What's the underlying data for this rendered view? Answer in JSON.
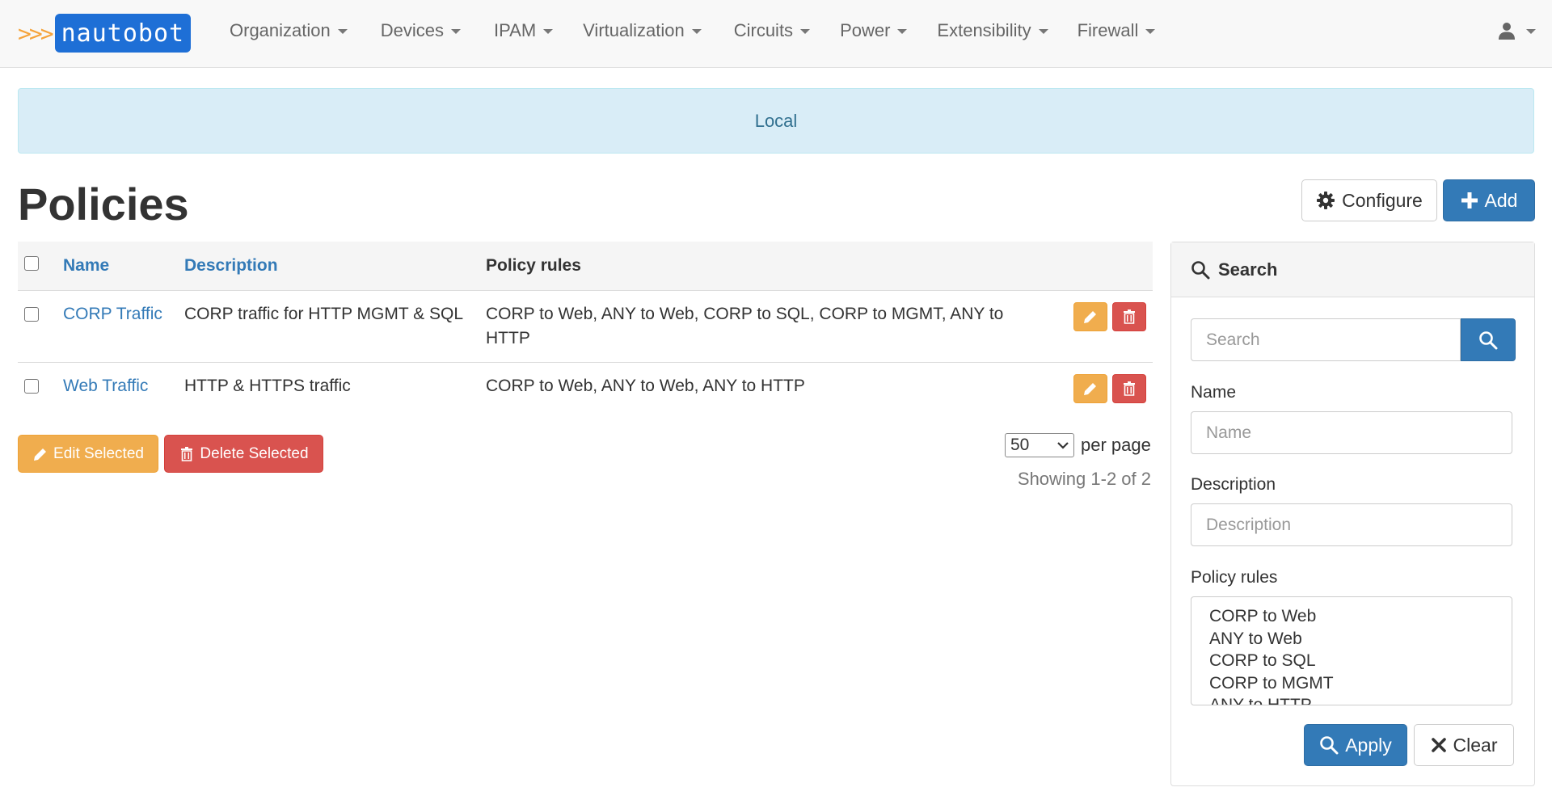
{
  "brand": {
    "arrows": ">>>",
    "name": "nautobot"
  },
  "nav": {
    "items": [
      {
        "label": "Organization"
      },
      {
        "label": "Devices"
      },
      {
        "label": "IPAM"
      },
      {
        "label": "Virtualization"
      },
      {
        "label": "Circuits"
      },
      {
        "label": "Power"
      },
      {
        "label": "Extensibility"
      },
      {
        "label": "Firewall"
      }
    ],
    "user_icon": "user-icon"
  },
  "banner": {
    "text": "Local"
  },
  "page": {
    "title": "Policies",
    "configure_label": "Configure",
    "add_label": "Add"
  },
  "table": {
    "columns": [
      "Name",
      "Description",
      "Policy rules"
    ],
    "rows": [
      {
        "name": "CORP Traffic",
        "description": "CORP traffic for HTTP MGMT & SQL",
        "policy_rules": "CORP to Web, ANY to Web, CORP to SQL, CORP to MGMT, ANY to HTTP"
      },
      {
        "name": "Web Traffic",
        "description": "HTTP & HTTPS traffic",
        "policy_rules": "CORP to Web, ANY to Web, ANY to HTTP"
      }
    ]
  },
  "bulk": {
    "edit_label": "Edit Selected",
    "delete_label": "Delete Selected"
  },
  "pagination": {
    "per_page_value": "50",
    "per_page_label": "per page",
    "showing": "Showing 1-2 of 2"
  },
  "search_panel": {
    "title": "Search",
    "q_placeholder": "Search",
    "name_label": "Name",
    "name_placeholder": "Name",
    "description_label": "Description",
    "description_placeholder": "Description",
    "policy_rules_label": "Policy rules",
    "policy_rules_options": [
      "CORP to Web",
      "ANY to Web",
      "CORP to SQL",
      "CORP to MGMT",
      "ANY to HTTP"
    ],
    "apply_label": "Apply",
    "clear_label": "Clear"
  },
  "colors": {
    "primary": "#337ab7",
    "warning": "#f0ad4e",
    "danger": "#d9534f",
    "info_bg": "#d9edf7",
    "brand_orange": "#f5a33b",
    "brand_blue": "#1e6fd6"
  }
}
